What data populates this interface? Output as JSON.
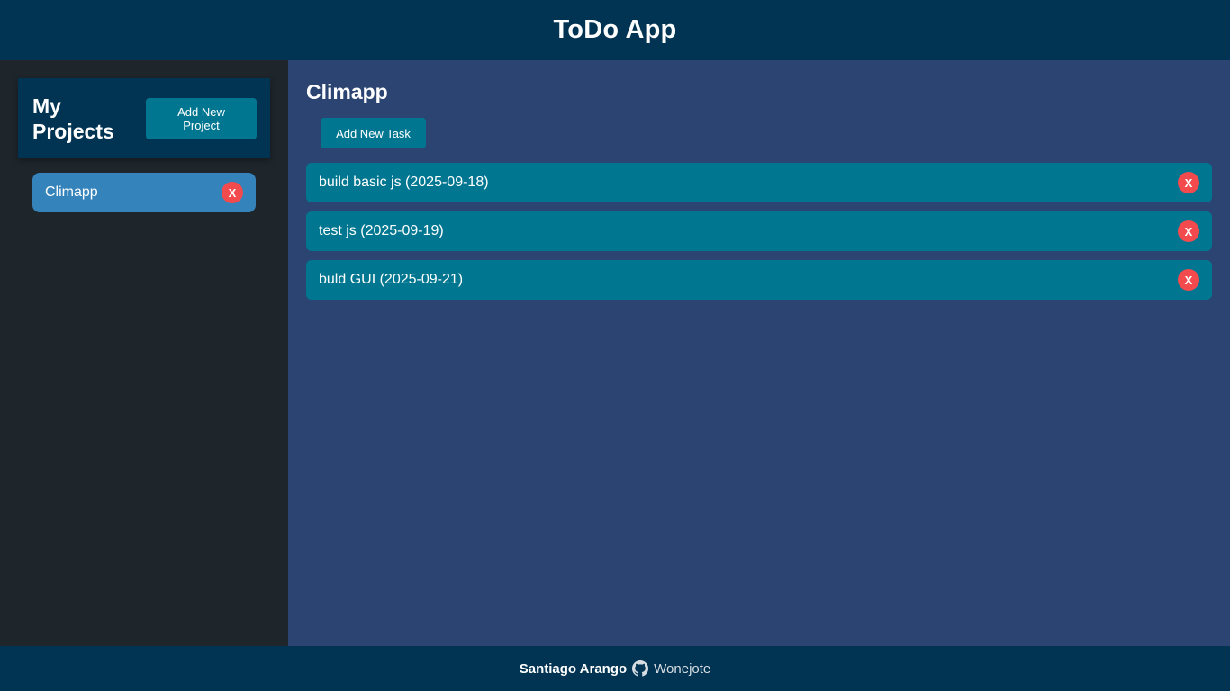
{
  "header": {
    "title": "ToDo App"
  },
  "sidebar": {
    "title": "My Projects",
    "add_project_label": "Add New Project",
    "projects": [
      {
        "name": "Climapp",
        "delete_label": "X"
      }
    ]
  },
  "main": {
    "project_title": "Climapp",
    "add_task_label": "Add New Task",
    "tasks": [
      {
        "text": "build basic js (2025-09-18)",
        "delete_label": "X"
      },
      {
        "text": "test js (2025-09-19)",
        "delete_label": "X"
      },
      {
        "text": "buld GUI (2025-09-21)",
        "delete_label": "X"
      }
    ]
  },
  "footer": {
    "author": "Santiago Arango",
    "github_icon": "github-icon",
    "github_user": "Wonejote"
  },
  "colors": {
    "header_bg": "#003452",
    "sidebar_bg": "#1e252b",
    "content_bg": "#2b4471",
    "accent": "#017690",
    "project_item_bg": "#3583bb",
    "delete_red": "#f24a4d"
  }
}
